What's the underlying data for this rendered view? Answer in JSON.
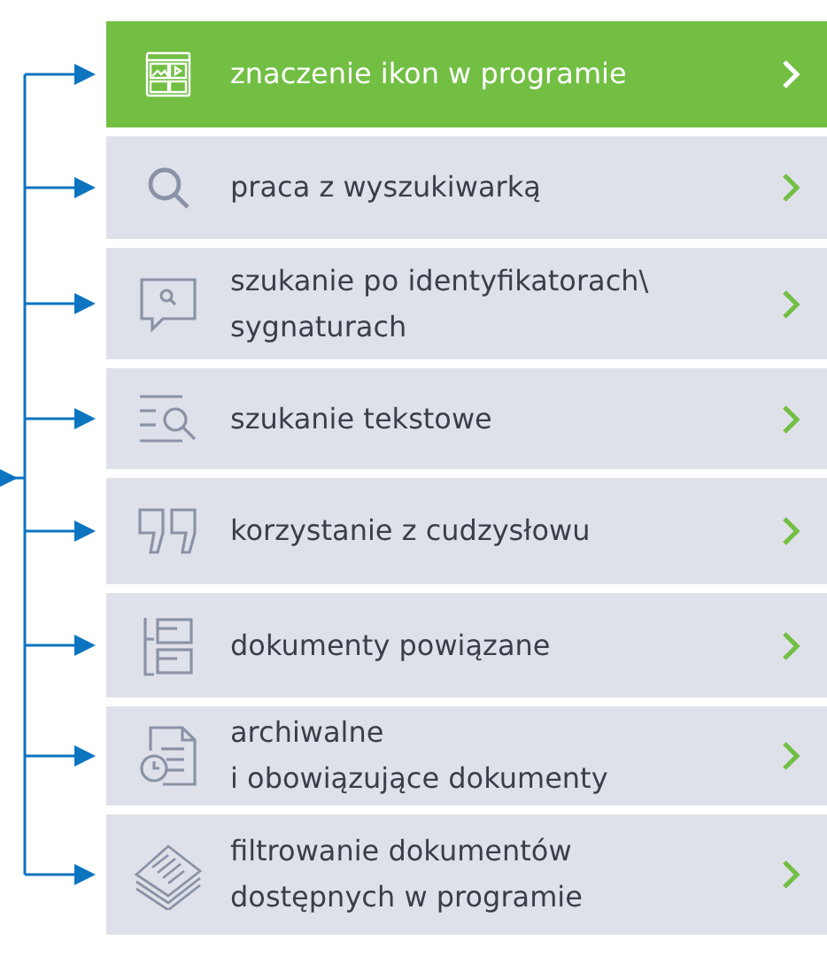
{
  "menu": [
    {
      "lines": [
        "znaczenie ikon w programie"
      ],
      "selected": true
    },
    {
      "lines": [
        "praca z wyszukiwarką"
      ],
      "selected": false
    },
    {
      "lines": [
        "szukanie po identyfikatorach\\",
        "sygnaturach"
      ],
      "selected": false
    },
    {
      "lines": [
        "szukanie tekstowe"
      ],
      "selected": false
    },
    {
      "lines": [
        "korzystanie z cudzysłowu"
      ],
      "selected": false
    },
    {
      "lines": [
        "dokumenty powiązane"
      ],
      "selected": false
    },
    {
      "lines": [
        "archiwalne",
        "i obowiązujące dokumenty"
      ],
      "selected": false
    },
    {
      "lines": [
        "filtrowanie dokumentów",
        "dostępnych w programie"
      ],
      "selected": false
    }
  ]
}
